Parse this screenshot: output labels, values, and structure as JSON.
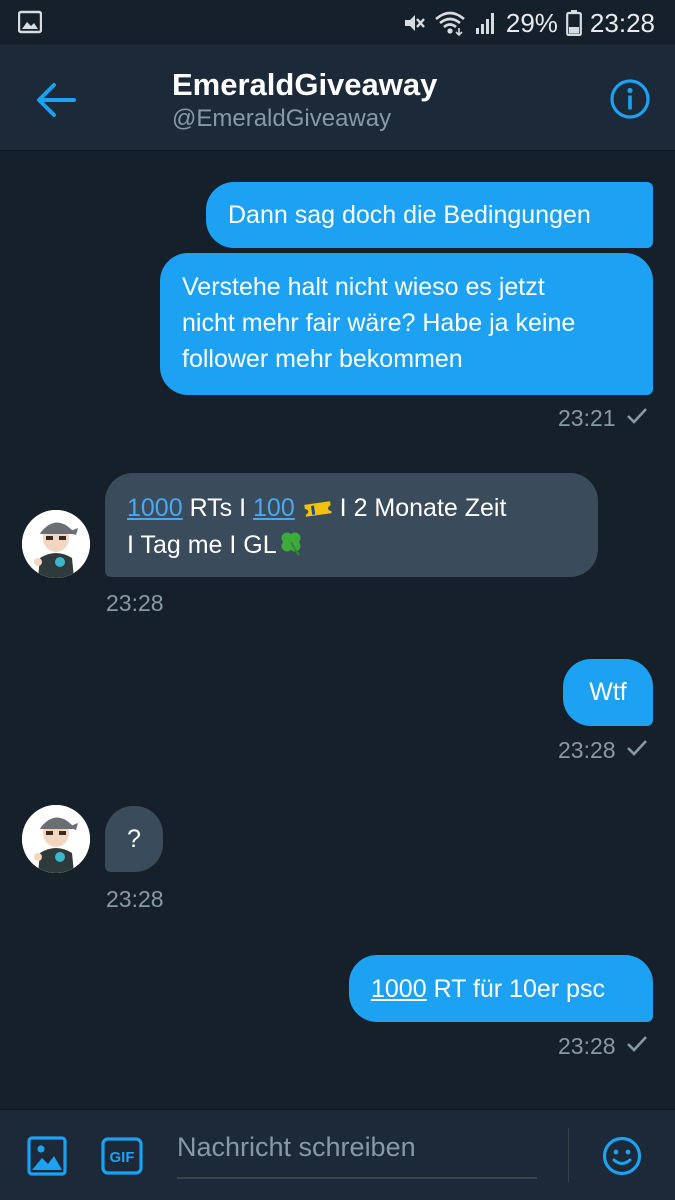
{
  "status_bar": {
    "battery": "29%",
    "time": "23:28",
    "icons": [
      "image-notification-icon",
      "mute-icon",
      "wifi-icon",
      "signal-icon",
      "battery-icon"
    ]
  },
  "header": {
    "name": "EmeraldGiveaway",
    "handle": "@EmeraldGiveaway",
    "icons": [
      "back-arrow-icon",
      "info-icon"
    ]
  },
  "messages": [
    {
      "direction": "outgoing",
      "text": "Dann sag doch die Bedingungen"
    },
    {
      "direction": "outgoing",
      "lines": [
        "Verstehe halt nicht wieso es jetzt",
        "nicht mehr fair wäre? Habe ja keine",
        "follower mehr bekommen"
      ],
      "time": "23:21",
      "read": true
    },
    {
      "direction": "incoming",
      "parts": {
        "n1": "1000",
        "t1": " RTs I ",
        "n2": "100",
        "t2": " I 2 Monate Zeit",
        "line2": "I Tag me I GL"
      },
      "emoji": [
        "ticket-icon",
        "four-leaf-clover-icon"
      ],
      "time": "23:28"
    },
    {
      "direction": "outgoing",
      "text": "Wtf",
      "time": "23:28",
      "read": true
    },
    {
      "direction": "incoming",
      "text": "?",
      "time": "23:28"
    },
    {
      "direction": "outgoing",
      "parts": {
        "n1": "1000",
        "t1": " RT für 10er psc"
      },
      "time": "23:28",
      "read": true
    }
  ],
  "composer": {
    "placeholder": "Nachricht schreiben",
    "gif_label": "GIF",
    "icons": [
      "image-icon",
      "gif-icon",
      "emoji-icon"
    ]
  },
  "colors": {
    "background": "#15202b",
    "header": "#1c2938",
    "accent": "#1da1f2",
    "incoming_bubble": "#3a4b5c",
    "muted_text": "#8899a6"
  }
}
